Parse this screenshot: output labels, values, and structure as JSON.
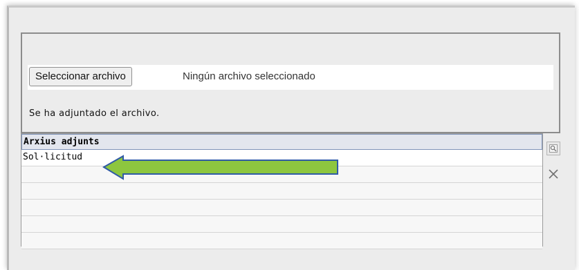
{
  "upload": {
    "button_label": "Seleccionar archivo",
    "status_text": "Ningún archivo seleccionado",
    "message": "Se ha adjuntado el archivo."
  },
  "attachments": {
    "header": "Arxius adjunts",
    "rows": [
      "Sol·licitud",
      "",
      "",
      "",
      "",
      ""
    ]
  },
  "icons": {
    "preview": "magnifier-icon",
    "delete": "close-icon",
    "annotation": "arrow-left-icon"
  },
  "colors": {
    "header_bg": "#e3e6ee",
    "header_border": "#7f93b8",
    "arrow_fill": "#8dc63f",
    "arrow_stroke": "#2f5aa6"
  }
}
